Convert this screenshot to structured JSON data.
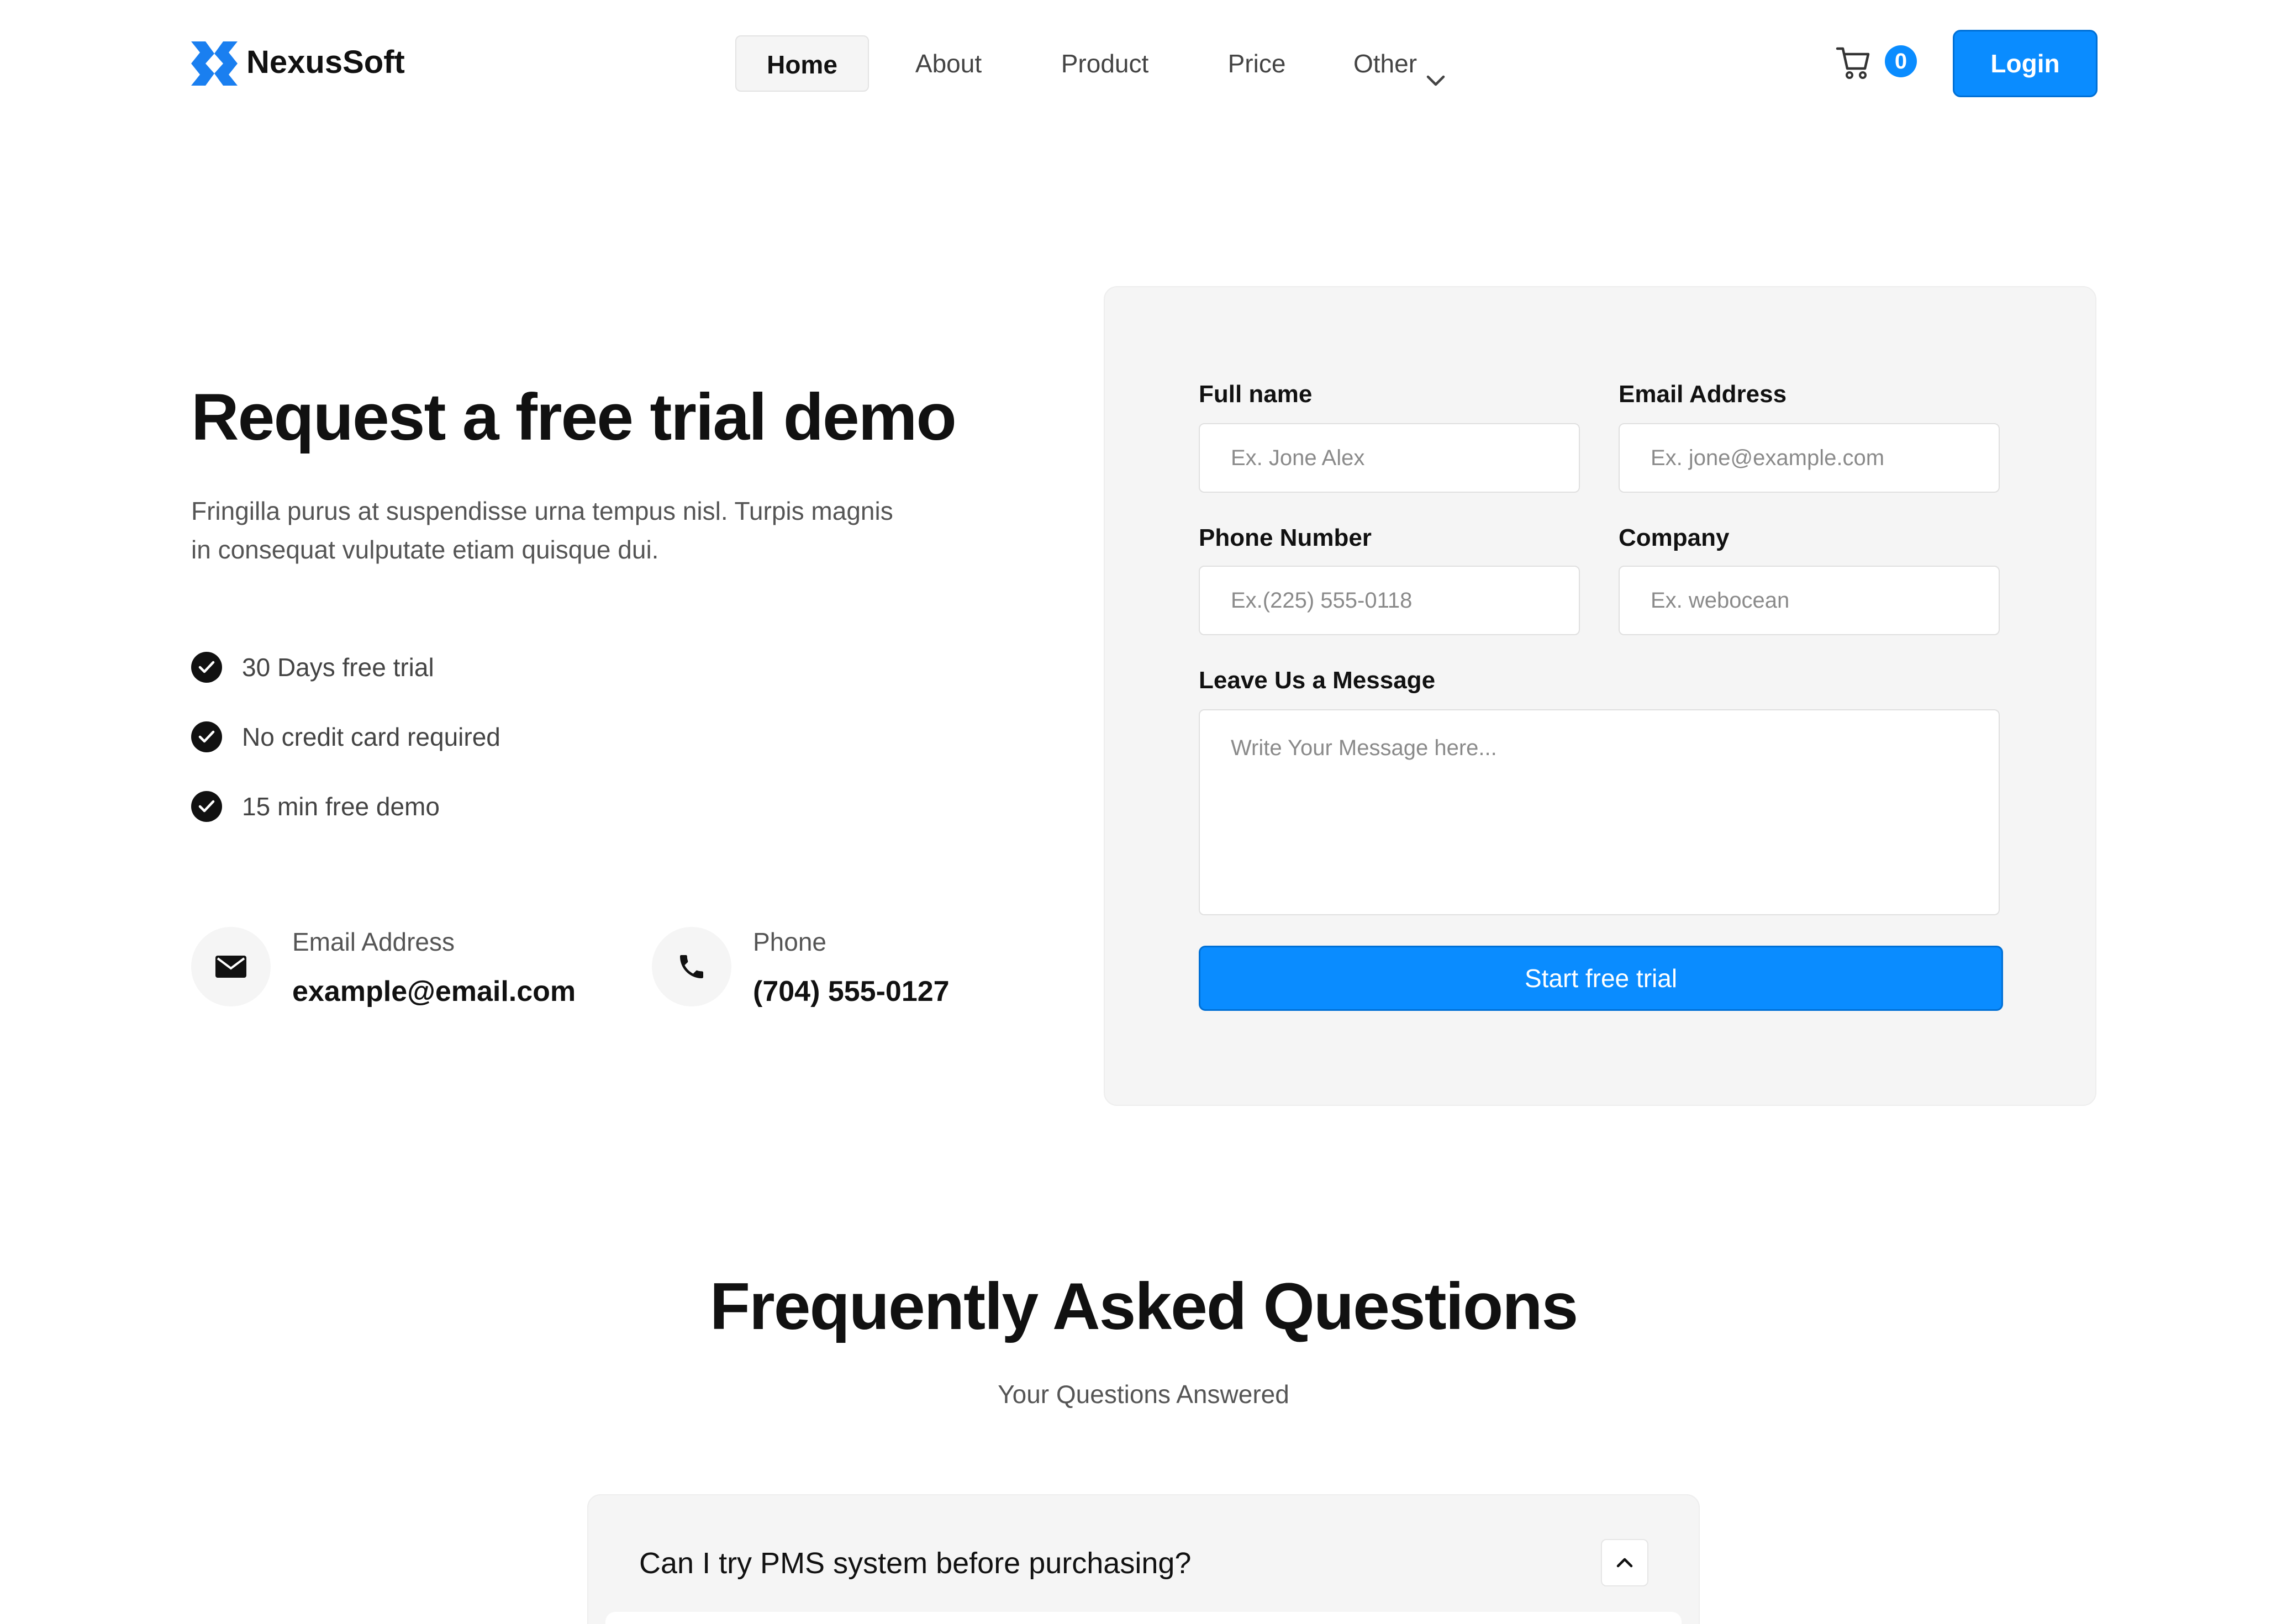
{
  "header": {
    "brand": "NexusSoft",
    "logo_icon": "nexussoft-logo-icon",
    "nav": [
      {
        "label": "Home",
        "active": true
      },
      {
        "label": "About"
      },
      {
        "label": "Product"
      },
      {
        "label": "Price"
      },
      {
        "label": "Other",
        "has_dropdown": true
      }
    ],
    "cart_count": "0",
    "login_label": "Login",
    "accent_color": "#0A8CFF"
  },
  "hero": {
    "title": "Request a free trial demo",
    "subtitle": "Fringilla purus at suspendisse urna tempus nisl. Turpis magnis in consequat vulputate etiam quisque dui.",
    "features": [
      "30 Days free trial",
      "No credit card required",
      "15 min free demo"
    ],
    "contacts": {
      "email": {
        "label": "Email Address",
        "value": "example@email.com",
        "icon": "envelope-icon"
      },
      "phone": {
        "label": "Phone",
        "value": "(704) 555-0127",
        "icon": "phone-icon"
      }
    }
  },
  "form": {
    "full_name": {
      "label": "Full name",
      "placeholder": "Ex. Jone Alex"
    },
    "email": {
      "label": "Email Address",
      "placeholder": "Ex. jone@example.com"
    },
    "phone": {
      "label": "Phone Number",
      "placeholder": "Ex.(225) 555-0118"
    },
    "company": {
      "label": "Company",
      "placeholder": "Ex. webocean"
    },
    "message": {
      "label": "Leave Us a Message",
      "placeholder": "Write Your Message here..."
    },
    "submit_label": "Start free trial"
  },
  "faq": {
    "title": "Frequently Asked Questions",
    "subtitle": "Your Questions Answered",
    "items": [
      {
        "question": "Can I try PMS system before purchasing?",
        "expanded": true
      }
    ]
  }
}
